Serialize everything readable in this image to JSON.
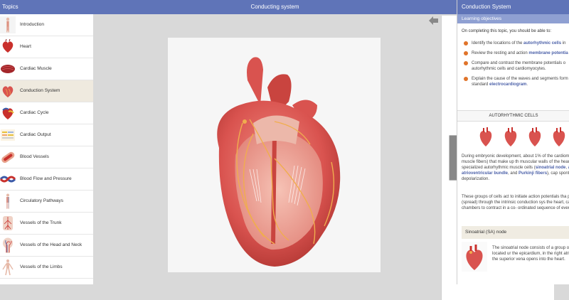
{
  "sidebar": {
    "title": "Topics",
    "items": [
      {
        "label": "Introduction",
        "thumb": "body-figure-icon",
        "active": false
      },
      {
        "label": "Heart",
        "thumb": "heart-icon",
        "active": false
      },
      {
        "label": "Cardiac Muscle",
        "thumb": "muscle-tissue-icon",
        "active": false
      },
      {
        "label": "Conduction System",
        "thumb": "conduction-heart-icon",
        "active": true
      },
      {
        "label": "Cardiac Cycle",
        "thumb": "cardiac-cycle-icon",
        "active": false
      },
      {
        "label": "Cardiac Output",
        "thumb": "chart-thumb-icon",
        "active": false
      },
      {
        "label": "Blood Vessels",
        "thumb": "vessel-icon",
        "active": false
      },
      {
        "label": "Blood Flow and Pressure",
        "thumb": "blood-flow-icon",
        "active": false
      },
      {
        "label": "Circulatory Pathways",
        "thumb": "circulation-figure-icon",
        "active": false
      },
      {
        "label": "Vessels of the Trunk",
        "thumb": "trunk-vessels-icon",
        "active": false
      },
      {
        "label": "Vessels of the Head and Neck",
        "thumb": "head-vessels-icon",
        "active": false
      },
      {
        "label": "Vessels of the Limbs",
        "thumb": "limb-vessels-icon",
        "active": false
      }
    ]
  },
  "center": {
    "title": "Conducting system"
  },
  "right": {
    "title": "Conduction System",
    "learning_objectives": "Learning objectives",
    "intro": "On completing this topic, you should be able to:",
    "objectives": [
      {
        "pre": "Identify the locations of the ",
        "bold": "autorhythmic cells",
        "post": " in"
      },
      {
        "pre": "Review the resting and action ",
        "bold": "membrane potentia",
        "post": ""
      },
      {
        "pre": "Compare and contrast the membrane potentials o autorhythmic cells and cardiomyocytes.",
        "bold": "",
        "post": ""
      },
      {
        "pre": "Explain the cause of the waves and segments form the standard ",
        "bold": "electrocardiogram",
        "post": "."
      }
    ],
    "autorhythmic_title": "AUTORHYTHMIC CELLS",
    "para1": {
      "a": "During embryonic development, about 1% of the cardiomyocytes (cardiac muscle fibers) that make up th muscular walls of the heart become highly specialized autorhythmic muscle cells (",
      "b1": "sinoatrial node",
      "c": ", ",
      "b2": "atrioventri node, atrioventricular bundle",
      "d": ", and ",
      "b3": "Purkinji fibers",
      "e": "), cap spontaneous depolarization."
    },
    "para2": "These groups of cells act to initiate action potentials tha propagate (spread) through the intrinsic conduction sys the heart, causing all four chambers to contract in a co- ordinated sequence of events.",
    "sa_title": "Sinoatrial (SA) node",
    "sa_text": "The sinoatrial node consists of a group o specialized autorhythmic cells located ur the epicardium, in the right atrium, just superolateral to where the superior vena opens into the heart."
  },
  "colors": {
    "header": "#5f74b8",
    "accent": "#e0742a",
    "link": "#4a5fa8",
    "heart": "#d9534f"
  }
}
